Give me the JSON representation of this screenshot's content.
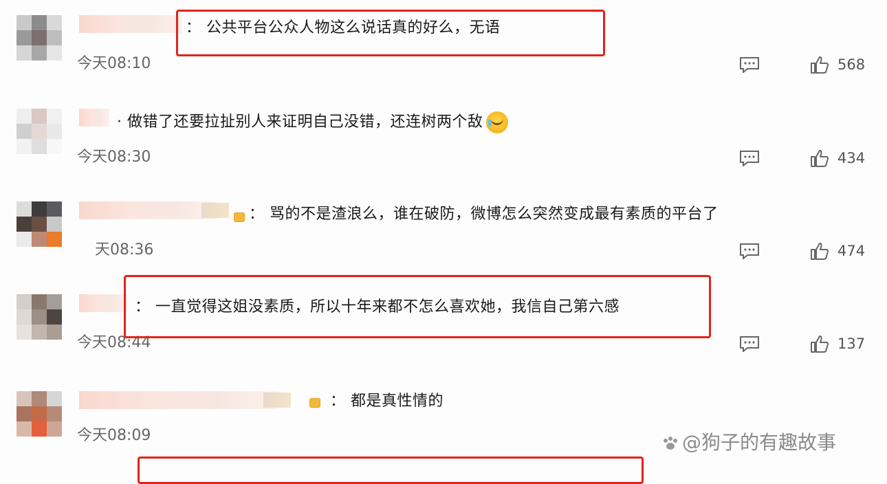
{
  "comments": [
    {
      "text": "： 公共平台公众人物这么说话真的好么，无语",
      "time": "今天08:10",
      "likes": "568",
      "highlighted": true
    },
    {
      "text": "· 做错了还要拉扯别人来证明自己没错，还连树两个敌",
      "time": "今天08:30",
      "likes": "434",
      "highlighted": false
    },
    {
      "text": "： 骂的不是渣浪么，谁在破防，微博怎么突然变成最有素质的平台了",
      "time": "天08:36",
      "likes": "474",
      "highlighted": false
    },
    {
      "text": "： 一直觉得这姐没素质，所以十年来都不怎么喜欢她，我信自己第六感",
      "time": "今天08:44",
      "likes": "137",
      "highlighted": true
    },
    {
      "text": "： 都是真性情的",
      "time": "今天08:09",
      "likes": "",
      "highlighted": false
    }
  ],
  "icons": {
    "reply": "comment-icon",
    "like": "thumbs-up-icon",
    "emoji": "laughing-crying-emoji"
  },
  "watermark": "@狗子的有趣故事",
  "colors": {
    "highlight_border": "#e2231a",
    "time_text": "#666666",
    "vip_badge": "#f3b83b"
  }
}
